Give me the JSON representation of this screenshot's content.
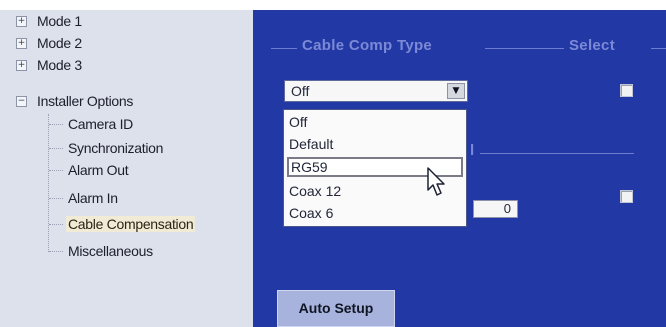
{
  "tree": {
    "items": [
      {
        "label": "Mode 1",
        "expander": "+"
      },
      {
        "label": "Mode 2",
        "expander": "+"
      },
      {
        "label": "Mode 3",
        "expander": "+"
      },
      {
        "label": "Installer Options",
        "expander": "−"
      }
    ],
    "children": [
      {
        "label": "Camera ID"
      },
      {
        "label": "Synchronization"
      },
      {
        "label": "Alarm Out"
      },
      {
        "label": "Alarm In"
      },
      {
        "label": "Cable Compensation"
      },
      {
        "label": "Miscellaneous"
      }
    ],
    "selected": "Cable Compensation"
  },
  "panel": {
    "section_title": "Cable Comp Type",
    "select_label": "Select",
    "second_section_fragment": "l",
    "combo": {
      "value": "Off",
      "arrow_icon": "▼"
    },
    "dropdown": {
      "options": [
        "Off",
        "Default",
        "RG59",
        "Coax 12",
        "Coax 6"
      ],
      "highlighted": "RG59"
    },
    "numeric_value": "0",
    "auto_setup_label": "Auto Setup"
  },
  "colors": {
    "panel_bg": "#2238a5",
    "tree_bg": "#dde1ec",
    "section_text": "#7b89d6",
    "button_bg": "#a7b3dc"
  }
}
